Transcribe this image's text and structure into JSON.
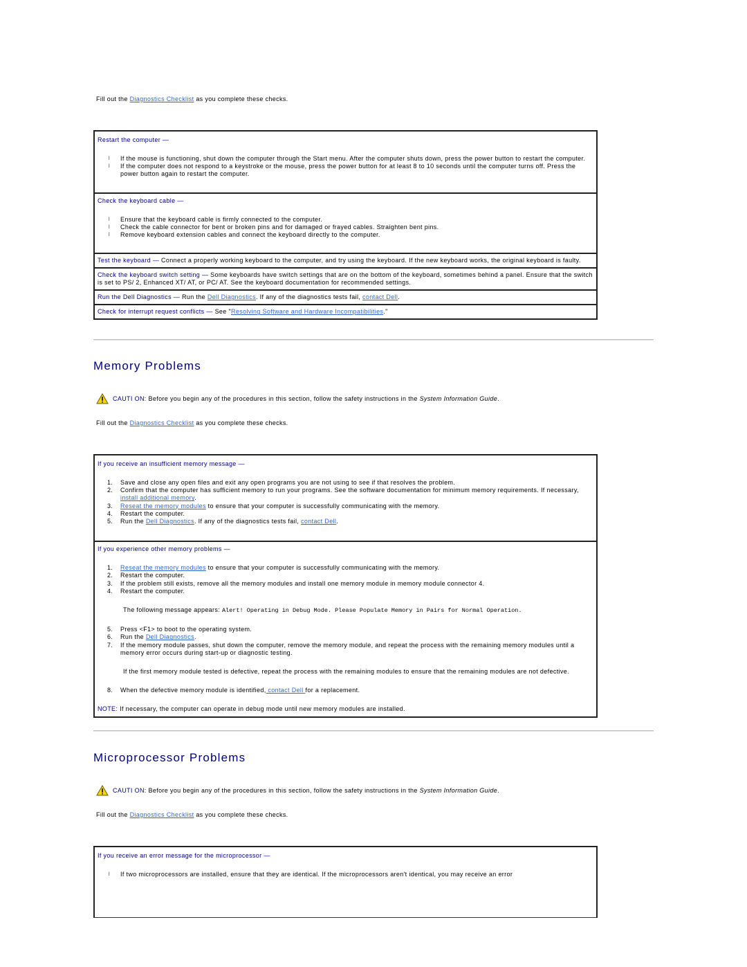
{
  "intro": {
    "prefix": "Fill out the ",
    "link": "Diagnostics Checklist",
    "suffix": " as you complete these checks."
  },
  "keyboard_table": {
    "restart": {
      "title": "Restart the computer —",
      "items": [
        "If the mouse is functioning, shut down the computer through the Start menu. After the computer shuts down, press the power button to restart the computer.",
        "If the computer does not respond to a keystroke or the mouse, press the power button for at least 8 to 10 seconds until the computer turns off. Press the power button again to restart the computer."
      ]
    },
    "cable": {
      "title": "Check the keyboard cable —",
      "items": [
        "Ensure that the keyboard cable is firmly connected to the computer.",
        "Check the cable connector for bent or broken pins and for damaged or frayed cables. Straighten bent pins.",
        "Remove keyboard extension cables and connect the keyboard directly to the computer."
      ]
    },
    "test": {
      "title": "Test the keyboard —",
      "text": " Connect a properly working keyboard to the computer, and try using the keyboard. If the new keyboard works, the original keyboard is faulty."
    },
    "switch": {
      "title": "Check the keyboard switch setting —",
      "text": " Some keyboards have switch settings that are on the bottom of the keyboard, sometimes behind a panel. Ensure that the switch is set to PS/ 2, Enhanced XT/ AT, or PC/ AT. See the keyboard documentation for recommended settings."
    },
    "diagnostics": {
      "title": "Run the Dell Diagnostics —",
      "pre": " Run the ",
      "link1": "Dell Diagnostics",
      "mid": ". If any of the diagnostics tests fail, ",
      "link2": "contact Dell",
      "post": "."
    },
    "irq": {
      "title": "Check for interrupt request conflicts —",
      "pre": " See \"",
      "link": "Resolving Software and Hardware Incompatibilities",
      "post": ".\""
    }
  },
  "memory": {
    "heading": "Memory Problems",
    "caution": {
      "label": "CAUTI ON:",
      "text": " Before you begin any of the procedures in this section, follow the safety instructions in the ",
      "guide": "System Information Guide",
      "end": "."
    },
    "intro": {
      "prefix": "Fill out the ",
      "link": "Diagnostics Checklist",
      "suffix": " as you complete these checks."
    },
    "insufficient": {
      "title": "If you receive an insufficient memory message —",
      "items": [
        {
          "n": "1.",
          "text": "Save and close any open files and exit any open programs you are not using to see if that resolves the problem."
        },
        {
          "n": "2.",
          "text": "Confirm that the computer has sufficient memory to run your programs. See the software documentation for minimum memory requirements. If necessary, ",
          "link": "install additional memory",
          "after": "."
        },
        {
          "n": "3.",
          "link_first": "Reseat the memory modules",
          "text": " to ensure that your computer is successfully communicating with the memory."
        },
        {
          "n": "4.",
          "text": "Restart the computer."
        },
        {
          "n": "5.",
          "text": "Run the ",
          "link": "Dell Diagnostics",
          "mid": ". If any of the diagnostics tests fail, ",
          "link2": "contact Dell",
          "after": "."
        }
      ]
    },
    "other": {
      "title": "If you experience other memory problems —",
      "items_a": [
        {
          "n": "1.",
          "link_first": "Reseat the memory modules",
          "text": " to ensure that your computer is successfully communicating with the memory."
        },
        {
          "n": "2.",
          "text": "Restart the computer."
        },
        {
          "n": "3.",
          "text": "If the problem still exists, remove all the memory modules and install one memory module in memory module connector 4."
        },
        {
          "n": "4.",
          "text": "Restart the computer."
        }
      ],
      "message_prefix": "The following message appears: ",
      "message_code": "Alert! Operating in Debug Mode. Please Populate Memory in Pairs for Normal Operation.",
      "items_b": [
        {
          "n": "5.",
          "text": "Press <F1> to boot to the operating system."
        },
        {
          "n": "6.",
          "text": "Run the ",
          "link": "Dell Diagnostics",
          "after": "."
        },
        {
          "n": "7.",
          "text": "If the memory module passes, shut down the computer, remove the memory module, and repeat the process with the remaining memory modules until a memory error occurs during start-up or diagnostic testing."
        }
      ],
      "sub_text": "If the first memory module tested is defective, repeat the process with the remaining modules to ensure that the remaining modules are not defective.",
      "item_8": {
        "n": "8.",
        "text": "When the defective memory module is identified,",
        "link": " contact Dell ",
        "after": "for a replacement."
      },
      "note_label": "NOTE:",
      "note_text": " If necessary, the computer can operate in debug mode until new memory modules are installed."
    }
  },
  "micro": {
    "heading": "Microprocessor Problems",
    "caution": {
      "label": "CAUTI ON:",
      "text": " Before you begin any of the procedures in this section, follow the safety instructions in the ",
      "guide": "System Information Guide",
      "end": "."
    },
    "intro": {
      "prefix": "Fill out the ",
      "link": "Diagnostics Checklist",
      "suffix": " as you complete these checks."
    },
    "error": {
      "title": "If you receive an error message for the microprocessor —",
      "items": [
        "If two microprocessors are installed, ensure that they are identical. If the microprocessors aren't identical, you may receive an error"
      ]
    }
  },
  "colors": {
    "heading": "#000080",
    "link": "#3366cc",
    "caution_icon": "#f5d800"
  }
}
